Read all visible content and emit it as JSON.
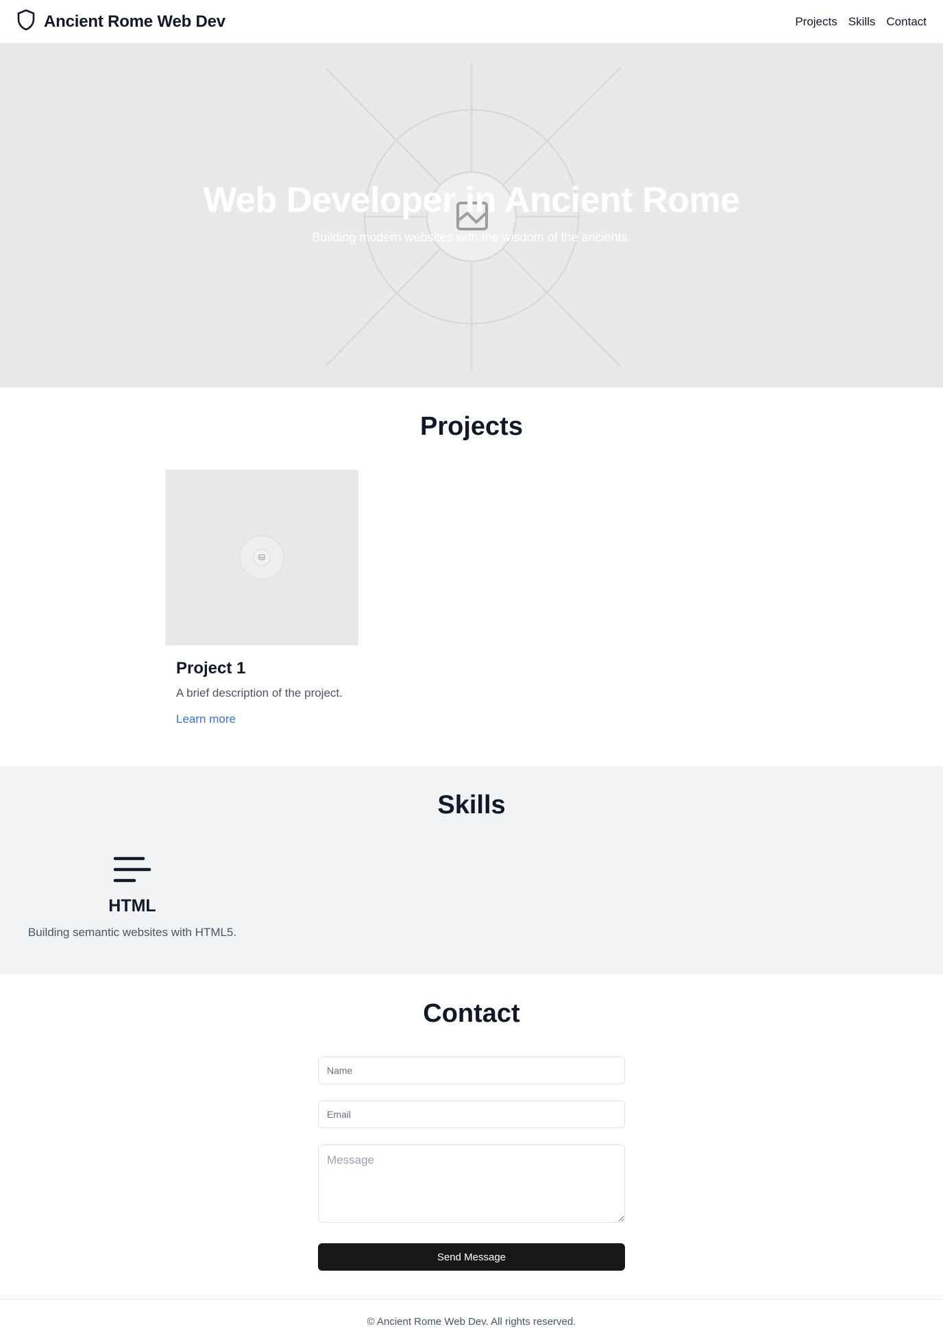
{
  "header": {
    "brand_icon": "shield-icon",
    "brand_title": "Ancient Rome Web Dev",
    "nav": [
      "Projects",
      "Skills",
      "Contact"
    ]
  },
  "hero": {
    "image_icon": "image-placeholder-icon",
    "title": "Web Developer in Ancient Rome",
    "subtitle": "Building modern websites with the wisdom of the ancients."
  },
  "projects": {
    "title": "Projects",
    "items": [
      {
        "image_icon": "image-placeholder-icon",
        "title": "Project 1",
        "description": "A brief description of the project.",
        "link": "Learn more"
      }
    ]
  },
  "skills": {
    "title": "Skills",
    "items": [
      {
        "icon": "align-left-icon",
        "title": "HTML",
        "description": "Building semantic websites with HTML5."
      }
    ]
  },
  "contact": {
    "title": "Contact",
    "name_placeholder": "Name",
    "email_placeholder": "Email",
    "message_placeholder": "Message",
    "submit_label": "Send Message"
  },
  "footer": {
    "text": "© Ancient Rome Web Dev. All rights reserved."
  },
  "colors": {
    "accent_link": "#3b6fd4",
    "button_bg": "#18181b",
    "placeholder_bg": "#e9e9e9",
    "skills_bg": "#f2f3f5"
  }
}
